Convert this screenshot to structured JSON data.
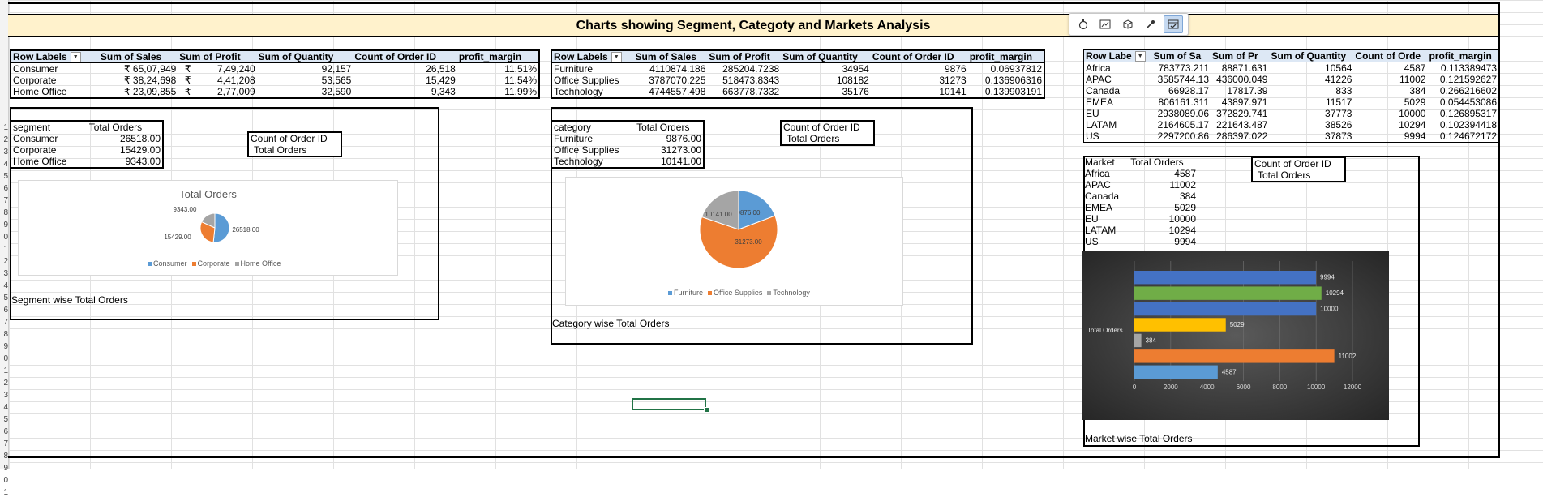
{
  "title": "Charts showing Segment, Categoty and Markets Analysis",
  "row_numbers": [
    "",
    "",
    "",
    "",
    "",
    "",
    "",
    "",
    "",
    "",
    "1",
    "2",
    "3",
    "4",
    "5",
    "6",
    "7",
    "8",
    "9",
    "0",
    "1",
    "2",
    "3",
    "4",
    "5",
    "6",
    "7",
    "8",
    "9",
    "0",
    "1",
    "2",
    "3",
    "4",
    "5",
    "6",
    "7",
    "8",
    "9",
    "0",
    "1"
  ],
  "toolbar": {
    "icons": [
      "info-icon",
      "chart-icon",
      "cube-icon",
      "magic-wand-icon",
      "table-check-icon"
    ]
  },
  "segment_pivot": {
    "headers": [
      "Row Labels",
      "Sum of Sales",
      "Sum of Profit",
      "Sum of Quantity",
      "Count of Order ID",
      "profit_margin"
    ],
    "rows": [
      [
        "Consumer",
        "₹ 65,07,949",
        "₹",
        "7,49,240",
        "92,157",
        "26,518",
        "11.51%"
      ],
      [
        "Corporate",
        "₹ 38,24,698",
        "₹",
        "4,41,208",
        "53,565",
        "15,429",
        "11.54%"
      ],
      [
        "Home Office",
        "₹ 23,09,855",
        "₹",
        "2,77,009",
        "32,590",
        "9,343",
        "11.99%"
      ]
    ]
  },
  "category_pivot": {
    "headers": [
      "Row Labels",
      "Sum of Sales",
      "Sum of Profit",
      "Sum of Quantity",
      "Count of Order ID",
      "profit_margin"
    ],
    "rows": [
      [
        "Furniture",
        "4110874.186",
        "285204.7238",
        "34954",
        "9876",
        "0.06937812"
      ],
      [
        "Office Supplies",
        "3787070.225",
        "518473.8343",
        "108182",
        "31273",
        "0.136906316"
      ],
      [
        "Technology",
        "4744557.498",
        "663778.7332",
        "35176",
        "10141",
        "0.139903191"
      ]
    ]
  },
  "market_pivot": {
    "headers": [
      "Row Labe",
      "Sum of Sa",
      "Sum of Pr",
      "Sum of Quantity",
      "Count of Orde",
      "profit_margin"
    ],
    "rows": [
      [
        "Africa",
        "783773.211",
        "88871.631",
        "10564",
        "4587",
        "0.113389473"
      ],
      [
        "APAC",
        "3585744.13",
        "436000.049",
        "41226",
        "11002",
        "0.121592627"
      ],
      [
        "Canada",
        "66928.17",
        "17817.39",
        "833",
        "384",
        "0.266216602"
      ],
      [
        "EMEA",
        "806161.311",
        "43897.971",
        "11517",
        "5029",
        "0.054453086"
      ],
      [
        "EU",
        "2938089.06",
        "372829.741",
        "37773",
        "10000",
        "0.126895317"
      ],
      [
        "LATAM",
        "2164605.17",
        "221643.487",
        "38526",
        "10294",
        "0.102394418"
      ],
      [
        "US",
        "2297200.86",
        "286397.022",
        "37873",
        "9994",
        "0.124672172"
      ]
    ]
  },
  "segment_summary": {
    "headers": [
      "segment",
      "Total Orders"
    ],
    "rows": [
      [
        "Consumer",
        "26518.00"
      ],
      [
        "Corporate",
        "15429.00"
      ],
      [
        "Home Office",
        "9343.00"
      ]
    ],
    "count_box": {
      "title": "Count of Order ID",
      "sub": "Total Orders"
    },
    "caption": "Segment wise Total Orders"
  },
  "category_summary": {
    "headers": [
      "category",
      "Total Orders"
    ],
    "rows": [
      [
        "Furniture",
        "9876.00"
      ],
      [
        "Office Supplies",
        "31273.00"
      ],
      [
        "Technology",
        "10141.00"
      ]
    ],
    "count_box": {
      "title": "Count of Order ID",
      "sub": "Total Orders"
    },
    "caption": "Category wise Total Orders"
  },
  "market_summary": {
    "headers": [
      "Market",
      "Total Orders"
    ],
    "rows": [
      [
        "Africa",
        "4587"
      ],
      [
        "APAC",
        "11002"
      ],
      [
        "Canada",
        "384"
      ],
      [
        "EMEA",
        "5029"
      ],
      [
        "EU",
        "10000"
      ],
      [
        "LATAM",
        "10294"
      ],
      [
        "US",
        "9994"
      ]
    ],
    "count_box": {
      "title": "Count of Order ID",
      "sub": "Total Orders"
    },
    "caption": "Market wise Total Orders"
  },
  "colors": {
    "blue": "#5b9bd5",
    "orange": "#ed7d31",
    "gray": "#a5a5a5",
    "yellow": "#ffc000",
    "green": "#70ad47",
    "darkblue": "#4472c4",
    "title_fill": "#fff2cc",
    "header_fill": "#dde8f5"
  },
  "chart_data": [
    {
      "type": "pie",
      "title": "Total Orders",
      "categories": [
        "Consumer",
        "Corporate",
        "Home Office"
      ],
      "values": [
        26518,
        15429,
        9343
      ],
      "labels": [
        "26518.00",
        "15429.00",
        "9343.00"
      ],
      "legend": "bottom"
    },
    {
      "type": "pie",
      "title": "",
      "categories": [
        "Furniture",
        "Office Supplies",
        "Technology"
      ],
      "values": [
        9876,
        31273,
        10141
      ],
      "labels": [
        "9876.00",
        "31273.00",
        "10141.00"
      ],
      "legend": "bottom"
    },
    {
      "type": "bar",
      "orientation": "horizontal",
      "title": "",
      "ylabel": "Total Orders",
      "categories": [
        "Africa",
        "APAC",
        "Canada",
        "EMEA",
        "EU",
        "LATAM",
        "US"
      ],
      "values": [
        4587,
        11002,
        384,
        5029,
        10000,
        10294,
        9994
      ],
      "xlim": [
        0,
        12000
      ],
      "xticks": [
        "0",
        "2000",
        "4000",
        "6000",
        "8000",
        "10000",
        "12000"
      ],
      "grid": true
    }
  ]
}
